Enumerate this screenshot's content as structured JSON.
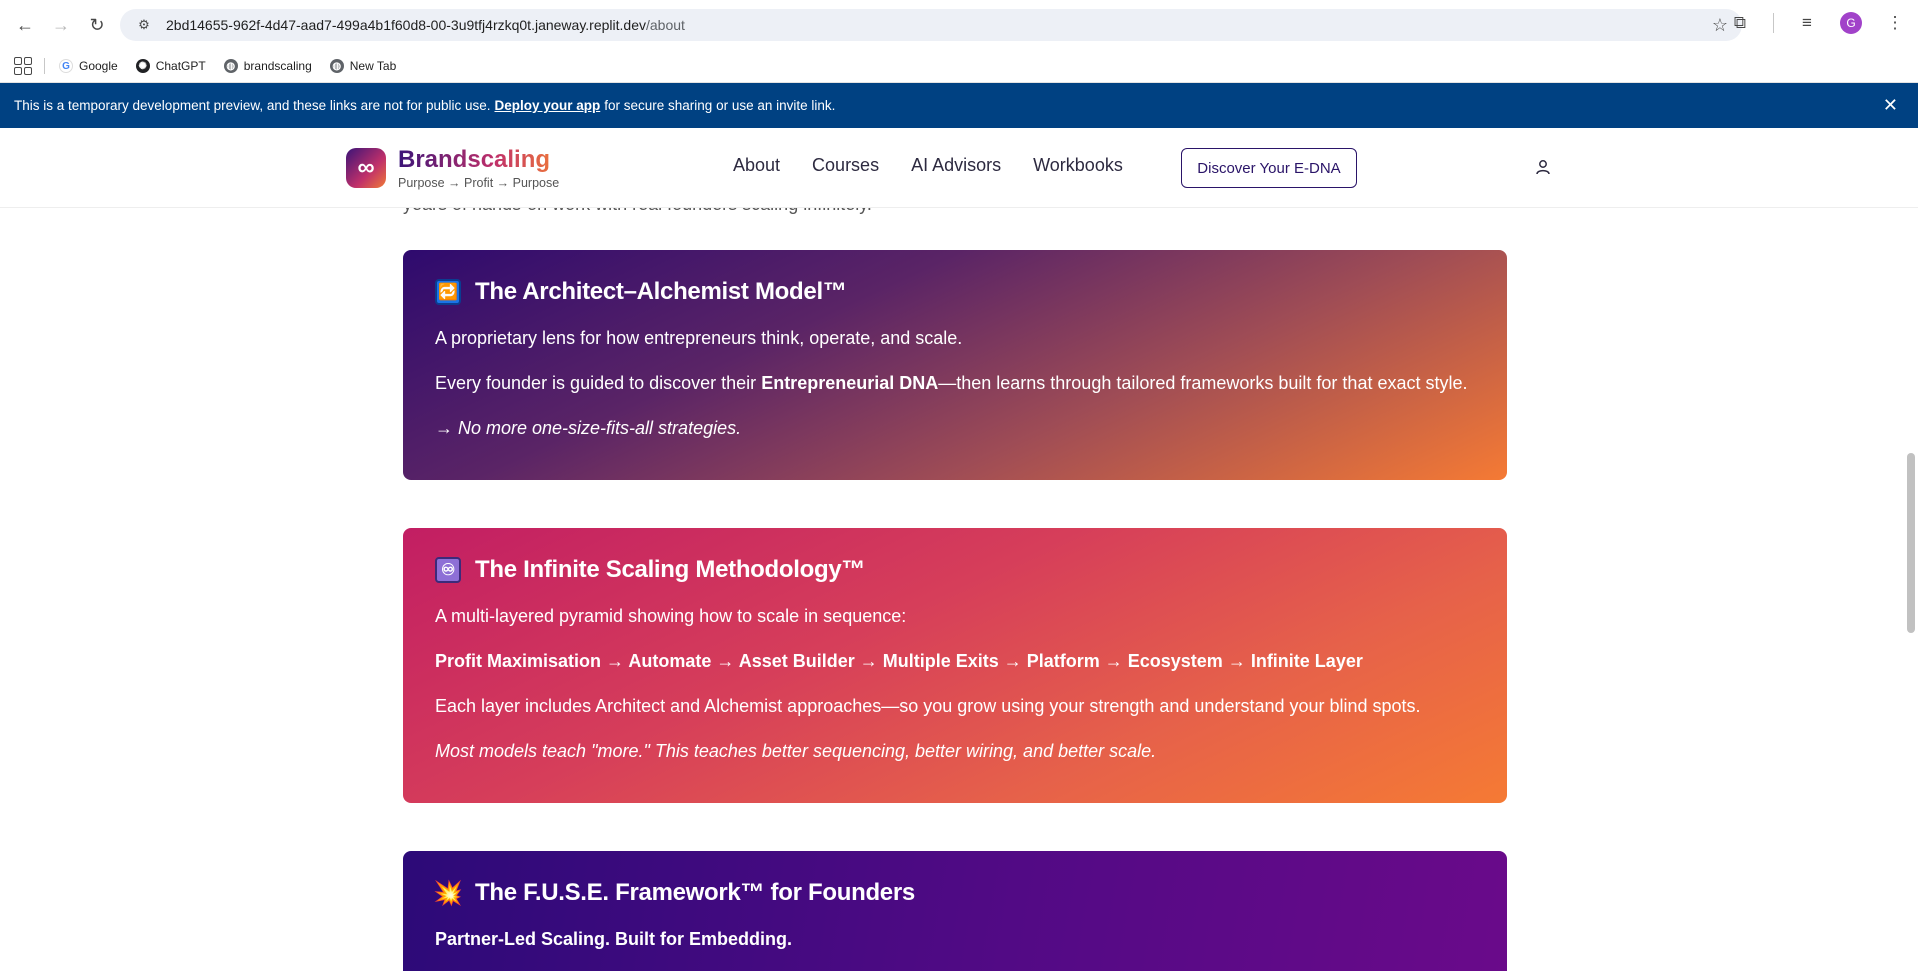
{
  "browser": {
    "url_host": "2bd14655-962f-4d47-aad7-499a4b1f60d8-00-3u9tfj4rzkq0t.janeway.replit.dev",
    "url_path": "/about",
    "avatar_letter": "G",
    "bookmarks": [
      {
        "label": "Google",
        "icon": "google-icon"
      },
      {
        "label": "ChatGPT",
        "icon": "chatgpt-icon"
      },
      {
        "label": "brandscaling",
        "icon": "globe-icon"
      },
      {
        "label": "New Tab",
        "icon": "globe-icon"
      }
    ]
  },
  "banner": {
    "text_before": "This is a temporary development preview, and these links are not for public use.",
    "link_text": "Deploy your app",
    "text_after": "for secure sharing or use an invite link."
  },
  "header": {
    "brand_name": "Brandscaling",
    "tagline": "Purpose → Profit → Purpose",
    "logo_symbol": "∞",
    "nav": [
      "About",
      "Courses",
      "AI Advisors",
      "Workbooks"
    ],
    "cta_label": "Discover Your E-DNA",
    "behind_text": "years of hands-on work with real founders scaling infinitely."
  },
  "cards": {
    "architect": {
      "emoji": "🔁",
      "title": "The Architect–Alchemist Model™",
      "p1": "A proprietary lens for how entrepreneurs think, operate, and scale.",
      "p2_before": "Every founder is guided to discover their",
      "p2_bold": "Entrepreneurial DNA",
      "p2_after": "—then learns through tailored frameworks built for that exact style.",
      "p3": "→ No more one-size-fits-all strategies."
    },
    "infinite": {
      "emoji": "♾",
      "title": "The Infinite Scaling Methodology™",
      "p1": "A multi-layered pyramid showing how to scale in sequence:",
      "p2": "Profit Maximisation → Automate → Asset Builder → Multiple Exits → Platform → Ecosystem → Infinite Layer",
      "p3": "Each layer includes Architect and Alchemist approaches—so you grow using your strength and understand your blind spots.",
      "p4": "Most models teach \"more.\" This teaches better sequencing, better wiring, and better scale."
    },
    "fuse": {
      "emoji": "💥",
      "title": "The F.U.S.E. Framework™ for Founders",
      "p1": "Partner-Led Scaling. Built for Embedding."
    }
  }
}
